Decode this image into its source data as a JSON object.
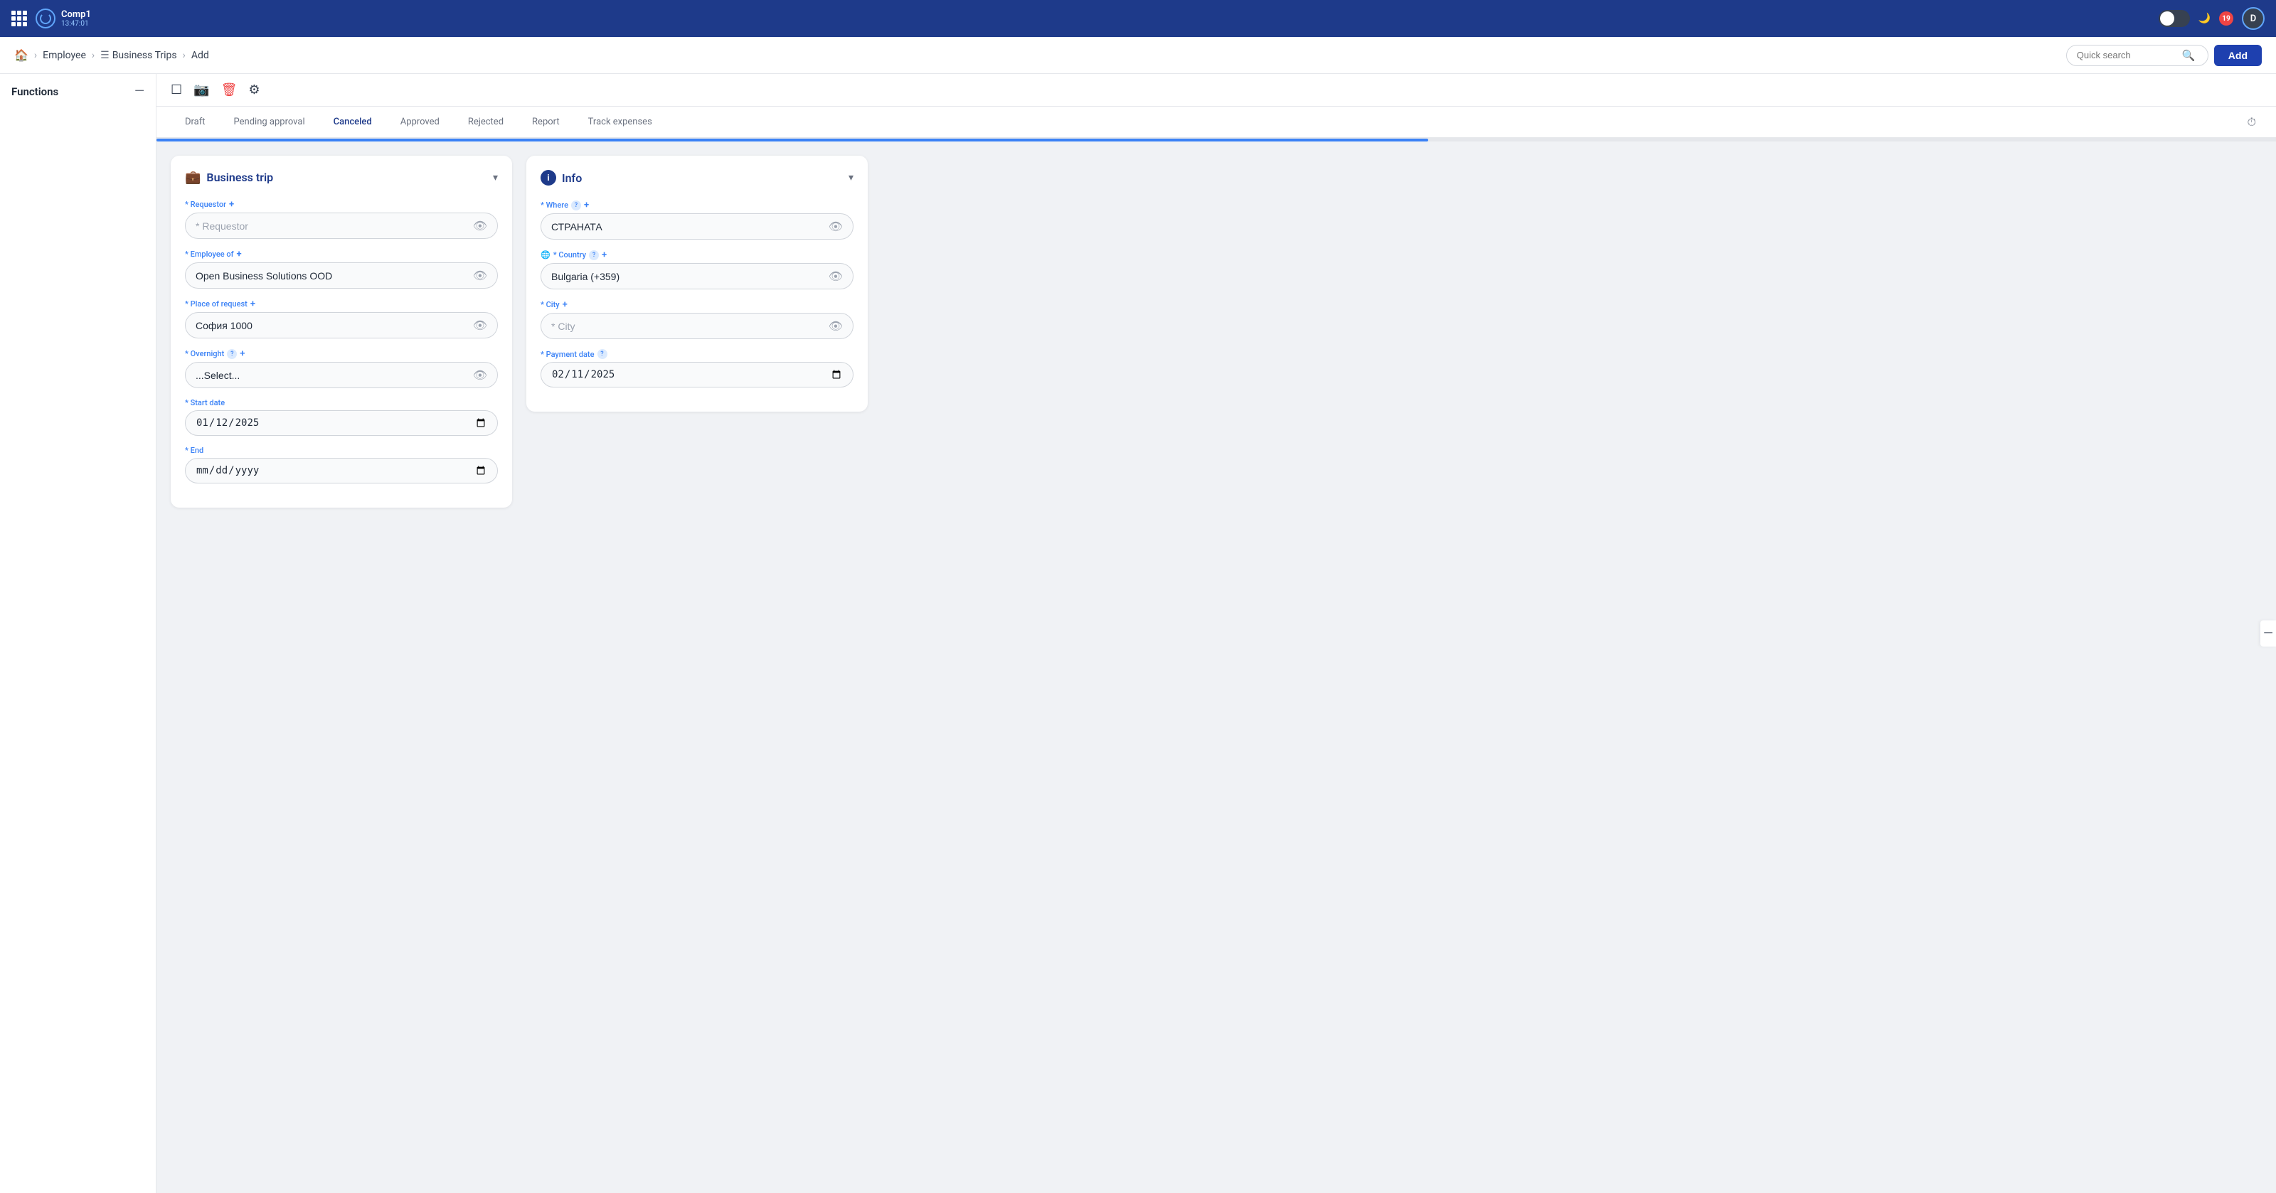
{
  "navbar": {
    "brand_name": "Comp1",
    "brand_time": "13:47:01",
    "notification_count": "19",
    "user_initial": "D"
  },
  "breadcrumb": {
    "home_label": "🏠",
    "items": [
      {
        "label": "Employee",
        "active": false
      },
      {
        "label": "Business Trips",
        "active": false
      },
      {
        "label": "Add",
        "active": true
      }
    ]
  },
  "search": {
    "placeholder": "Quick search"
  },
  "toolbar_buttons": {
    "add_label": "Add"
  },
  "sidebar": {
    "title": "Functions",
    "collapse_symbol": "—"
  },
  "status_tabs": [
    {
      "label": "Draft",
      "active": false
    },
    {
      "label": "Pending approval",
      "active": false
    },
    {
      "label": "Canceled",
      "active": true
    },
    {
      "label": "Approved",
      "active": false
    },
    {
      "label": "Rejected",
      "active": false
    },
    {
      "label": "Report",
      "active": false
    },
    {
      "label": "Track expenses",
      "active": false
    }
  ],
  "business_trip_card": {
    "title": "Business trip",
    "icon": "💼",
    "fields": [
      {
        "key": "requestor",
        "label": "* Requestor",
        "has_add": true,
        "value": "",
        "placeholder": "* Requestor"
      },
      {
        "key": "employee_of",
        "label": "* Employee of",
        "has_add": true,
        "value": "Open Business Solutions OOD",
        "placeholder": ""
      },
      {
        "key": "place_of_request",
        "label": "* Place of request",
        "has_add": true,
        "value": "София 1000",
        "placeholder": ""
      },
      {
        "key": "overnight",
        "label": "* Overnight",
        "has_help": true,
        "has_add": true,
        "value": "...Select...",
        "placeholder": ""
      },
      {
        "key": "start_date",
        "label": "* Start date",
        "type": "date",
        "value": "2025-01-12",
        "placeholder": "mm/dd/yyyy"
      },
      {
        "key": "end",
        "label": "* End",
        "type": "date",
        "value": "",
        "placeholder": "mm/dd/yyyy"
      }
    ]
  },
  "info_card": {
    "title": "Info",
    "icon": "ℹ",
    "fields": [
      {
        "key": "where",
        "label": "* Where",
        "has_help": true,
        "has_add": true,
        "value": "СТРАНАТА",
        "placeholder": ""
      },
      {
        "key": "country",
        "label": "🌐 * Country",
        "has_help": true,
        "has_add": true,
        "value": "Bulgaria (+359)",
        "placeholder": ""
      },
      {
        "key": "city",
        "label": "* City",
        "has_add": true,
        "value": "",
        "placeholder": "* City"
      },
      {
        "key": "payment_date",
        "label": "* Payment date",
        "has_help": true,
        "type": "date",
        "value": "2025-02-11",
        "placeholder": "mm/dd/yyyy"
      }
    ]
  }
}
